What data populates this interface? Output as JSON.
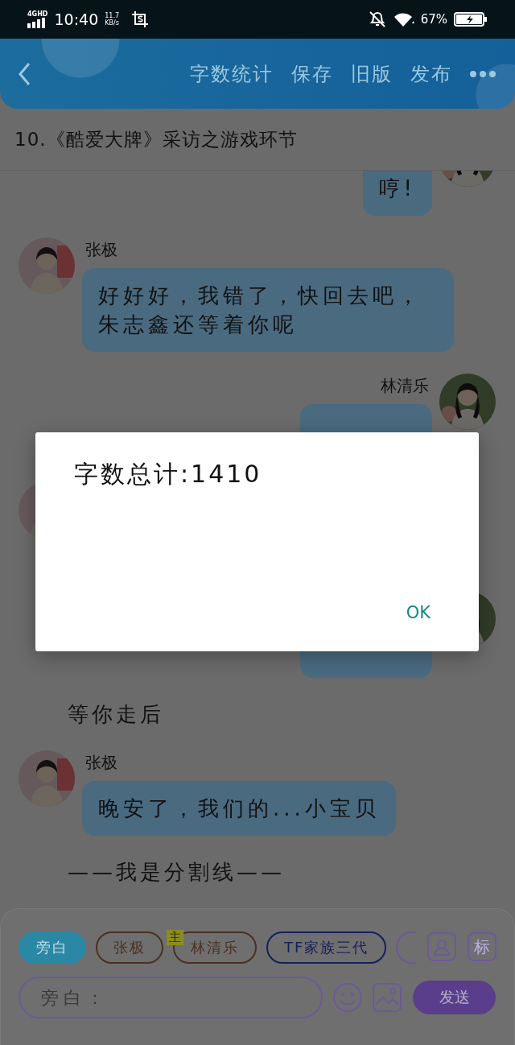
{
  "status_bar": {
    "network": "4GHD",
    "time": "10:40",
    "speed": "11.7",
    "speed_unit": "KB/s",
    "battery": "67%"
  },
  "header": {
    "actions": [
      "字数统计",
      "保存",
      "旧版",
      "发布"
    ]
  },
  "chapter_title": "10.《酷爱大牌》采访之游戏环节",
  "messages": [
    {
      "kind": "message",
      "outgoing": true,
      "text": "哼!"
    },
    {
      "kind": "message",
      "outgoing": false,
      "speaker": "张极",
      "text": "好好好，我错了，快回去吧，朱志鑫还等着你呢"
    },
    {
      "kind": "message",
      "outgoing": true,
      "speaker": "林清乐"
    },
    {
      "kind": "message",
      "outgoing": false
    },
    {
      "kind": "message",
      "outgoing": true
    },
    {
      "kind": "narration",
      "text": "等你走后"
    },
    {
      "kind": "message",
      "outgoing": false,
      "speaker": "张极",
      "text": "晚安了，我们的...小宝贝"
    },
    {
      "kind": "narration",
      "text": "——我是分割线——"
    }
  ],
  "composer": {
    "roles": [
      {
        "label": "旁白",
        "selected": true,
        "color": "#2a88a4"
      },
      {
        "label": "张极",
        "selected": false,
        "color": "#4a3022"
      },
      {
        "label": "林清乐",
        "selected": false,
        "color": "#4a3022",
        "badge": "主"
      },
      {
        "label": "TF家族三代",
        "selected": false,
        "color": "#14205c"
      },
      {
        "selected": false,
        "color": "#6c5a94"
      }
    ],
    "side_button": "标",
    "placeholder": "旁白：",
    "send": "发送"
  },
  "dialog": {
    "message": "字数总计:1410",
    "button": "OK"
  }
}
